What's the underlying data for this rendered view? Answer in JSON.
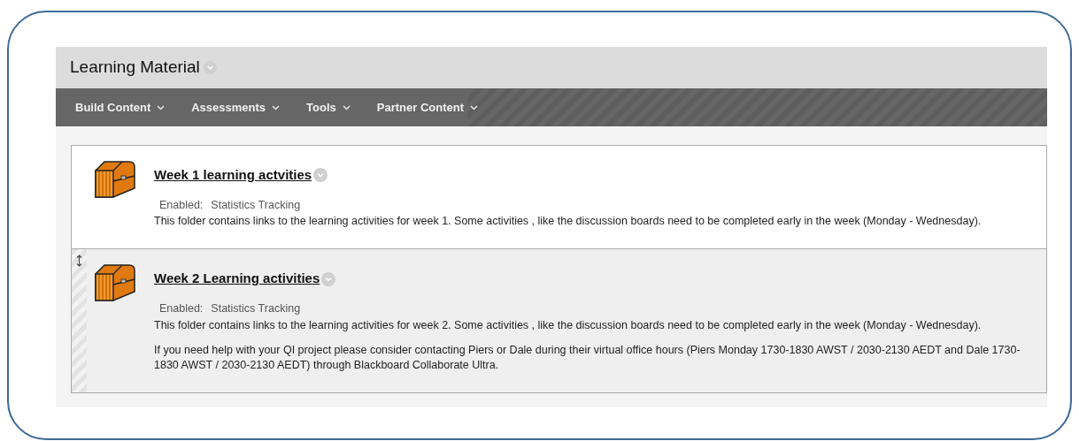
{
  "page_title": "Learning Material",
  "menu": [
    {
      "label": "Build Content"
    },
    {
      "label": "Assessments"
    },
    {
      "label": "Tools"
    },
    {
      "label": "Partner Content"
    }
  ],
  "items": [
    {
      "title": "Week 1 learning actvities",
      "hovered": false,
      "enabled_label": "Enabled:",
      "enabled_value": "Statistics Tracking",
      "paragraphs": [
        "This folder contains links to the learning activities for week 1. Some activities , like the discussion boards need to be completed early in the week (Monday - Wednesday)."
      ]
    },
    {
      "title": "Week 2 Learning activities",
      "hovered": true,
      "enabled_label": "Enabled:",
      "enabled_value": "Statistics Tracking",
      "paragraphs": [
        "This folder contains links to the learning activities for week 2. Some activities , like the discussion boards need to be completed early in the week (Monday - Wednesday).",
        "If you need help with your QI project please consider contacting Piers or Dale during their virtual office hours (Piers Monday 1730-1830 AWST / 2030-2130 AEDT and Dale 1730-1830 AWST / 2030-2130 AEDT) through Blackboard Collaborate Ultra."
      ]
    }
  ]
}
